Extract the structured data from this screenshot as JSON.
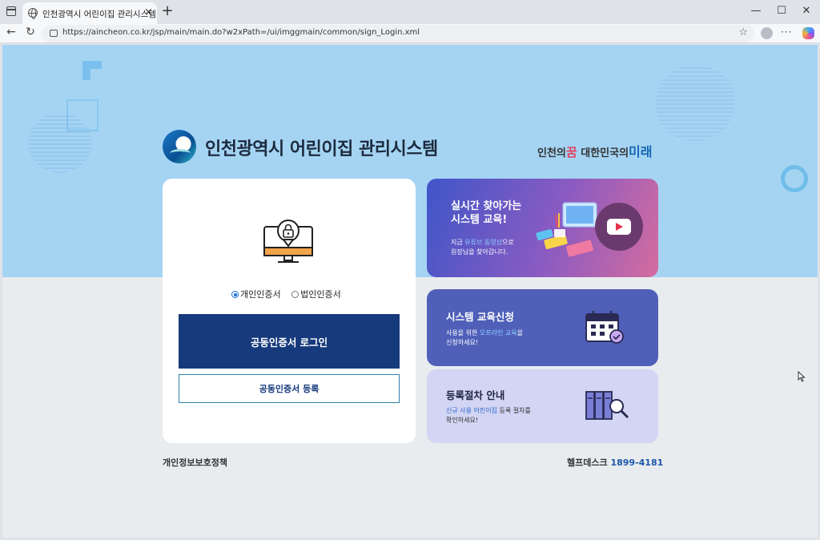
{
  "browser": {
    "tab_title": "인천광역시 어린이집 관리시스템",
    "tab_close": "×",
    "new_tab": "+",
    "url": "https://aincheon.co.kr/jsp/main/main.do?w2xPath=/ui/imggmain/common/sign_Login.xml",
    "window_controls": {
      "minimize": "—",
      "maximize": "☐",
      "close": "✕"
    },
    "nav": {
      "back": "←",
      "refresh": "↻"
    },
    "favorite": "☆",
    "more": "···"
  },
  "header": {
    "site_title": "인천광역시 어린이집 관리시스템",
    "slogan_part1": "인천의",
    "slogan_dream": "꿈",
    "slogan_part2": "대한민국의",
    "slogan_future": "미래"
  },
  "login": {
    "cert_options": [
      {
        "label": "개인인증서",
        "selected": true
      },
      {
        "label": "법인인증서",
        "selected": false
      }
    ],
    "login_button": "공동인증서 로그인",
    "register_button": "공동인증서 등록"
  },
  "cards": {
    "visit": {
      "title_line1": "실시간 찾아가는",
      "title_line2": "시스템 교육!",
      "sub_prefix": "지금 ",
      "sub_highlight": "유튜브 동영상",
      "sub_suffix": "으로",
      "sub_line2": "원장님을 찾아갑니다."
    },
    "apply": {
      "title": "시스템 교육신청",
      "sub_prefix": "사용을 위한 ",
      "sub_highlight": "오프라인 교육",
      "sub_suffix": "을",
      "sub_line2": "신청하세요!"
    },
    "guide": {
      "title": "등록절차 안내",
      "sub_highlight": "신규 사용 어린이집",
      "sub_suffix": " 등록 절차를",
      "sub_line2": "확인하세요!"
    }
  },
  "footer": {
    "privacy_policy": "개인정보보호정책",
    "helpdesk_label": "헬프데스크",
    "helpdesk_phone": "1899-4181"
  },
  "colors": {
    "hero_bg": "#a5d4f3",
    "login_button": "#163a7c",
    "apply_card": "#5060b9",
    "guide_card": "#d2d5f3"
  }
}
